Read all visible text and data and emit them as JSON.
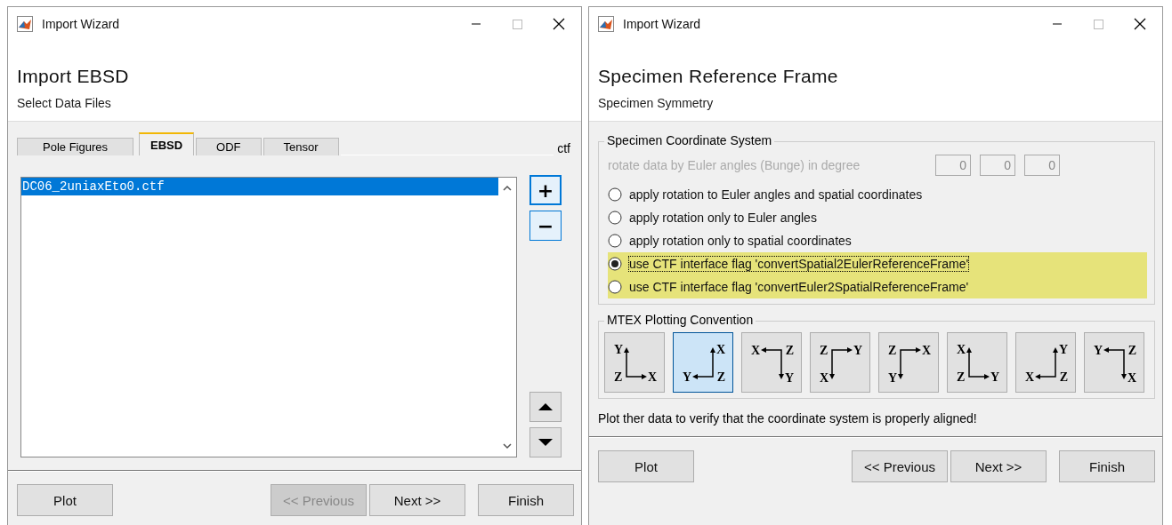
{
  "windows": [
    {
      "title": "Import Wizard",
      "heading": "Import EBSD",
      "subheading": "Select Data Files",
      "kind": "files",
      "tabs": [
        {
          "label": "Pole Figures",
          "selected": false
        },
        {
          "label": "EBSD",
          "selected": true
        },
        {
          "label": "ODF",
          "selected": false
        },
        {
          "label": "Tensor",
          "selected": false
        }
      ],
      "format": "ctf",
      "files": [
        {
          "name": "DC06_2uniaxEto0.ctf",
          "selected": true
        }
      ],
      "add_label": "+",
      "remove_label": "−",
      "buttons": [
        {
          "label": "Plot",
          "disabled": false
        },
        {
          "label": "<< Previous",
          "disabled": true
        },
        {
          "label": "Next >>",
          "disabled": false
        },
        {
          "label": "Finish",
          "disabled": false
        }
      ]
    },
    {
      "title": "Import Wizard",
      "heading": "Specimen Reference Frame",
      "subheading": "Specimen Symmetry",
      "kind": "frame",
      "coord_group": "Specimen Coordinate System",
      "rotate_label": "rotate data by Euler angles (Bunge) in degree",
      "angles": [
        "0",
        "0",
        "0"
      ],
      "options": [
        {
          "label": "apply rotation to Euler angles and spatial coordinates",
          "selected": false,
          "highlighted": false
        },
        {
          "label": "apply rotation only to Euler angles",
          "selected": false,
          "highlighted": false
        },
        {
          "label": "apply rotation only to spatial coordinates",
          "selected": false,
          "highlighted": false
        },
        {
          "label": "use CTF interface flag 'convertSpatial2EulerReferenceFrame'",
          "selected": true,
          "highlighted": true
        },
        {
          "label": "use CTF interface flag 'convertEuler2SpatialReferenceFrame'",
          "selected": false,
          "highlighted": true
        }
      ],
      "convention_group": "MTEX Plotting Convention",
      "conventions": [
        {
          "kind": "upright",
          "corner": "Z",
          "horizontal": "X",
          "vertical": "Y",
          "selected": false
        },
        {
          "kind": "upleft",
          "corner": "Z",
          "horizontal": "Y",
          "vertical": "X",
          "selected": true
        },
        {
          "kind": "downleft",
          "corner": "Z",
          "horizontal": "X",
          "vertical": "Y",
          "selected": false
        },
        {
          "kind": "downright",
          "corner": "Z",
          "horizontal": "Y",
          "vertical": "X",
          "selected": false
        },
        {
          "kind": "downright",
          "corner": "Z",
          "horizontal": "X",
          "vertical": "Y",
          "selected": false
        },
        {
          "kind": "upright",
          "corner": "Z",
          "horizontal": "Y",
          "vertical": "X",
          "selected": false
        },
        {
          "kind": "upleft",
          "corner": "Z",
          "horizontal": "X",
          "vertical": "Y",
          "selected": false
        },
        {
          "kind": "downleft",
          "corner": "Z",
          "horizontal": "Y",
          "vertical": "X",
          "selected": false
        }
      ],
      "note": "Plot ther data to verify that the coordinate system is properly aligned!",
      "buttons": [
        {
          "label": "Plot",
          "disabled": false
        },
        {
          "label": "<< Previous",
          "disabled": false
        },
        {
          "label": "Next >>",
          "disabled": false
        },
        {
          "label": "Finish",
          "disabled": false
        }
      ]
    }
  ]
}
